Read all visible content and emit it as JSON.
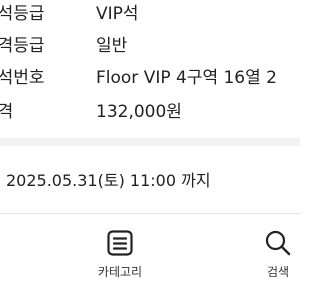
{
  "ticket_info": [
    {
      "label": "좌석등급",
      "value": "VIP석"
    },
    {
      "label": "가격등급",
      "value": "일반"
    },
    {
      "label": "좌석번호",
      "value": "Floor VIP 4구역 16열 2"
    },
    {
      "label": "가격",
      "value": "132,000원"
    }
  ],
  "deadline": {
    "text": "2025.05.31(토) 11:00 까지"
  },
  "tabbar": {
    "tabs": [
      {
        "label": "카테고리",
        "icon": "category-list-icon"
      },
      {
        "label": "검색",
        "icon": "search-icon"
      }
    ]
  }
}
